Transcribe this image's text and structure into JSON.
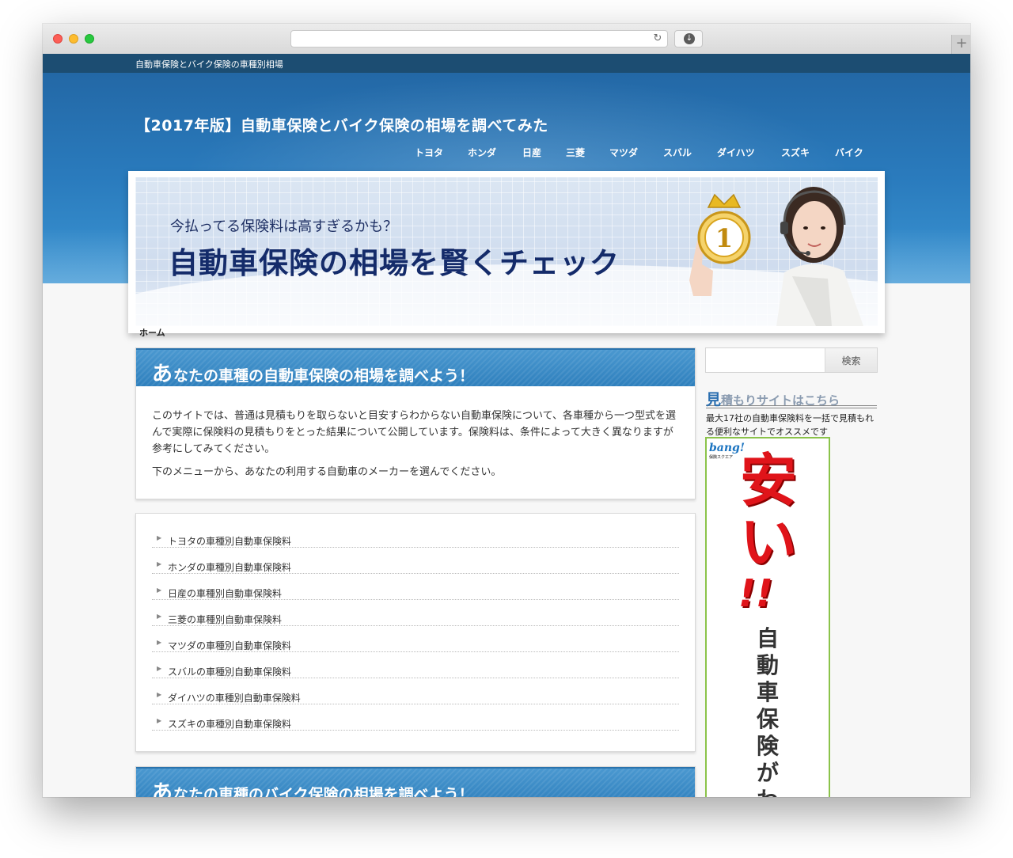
{
  "page": {
    "topbar_text": "自動車保険とバイク保険の車種別相場",
    "site_title": "【2017年版】自動車保険とバイク保険の相場を調べてみた"
  },
  "nav": {
    "items": [
      "トヨタ",
      "ホンダ",
      "日産",
      "三菱",
      "マツダ",
      "スバル",
      "ダイハツ",
      "スズキ",
      "バイク"
    ]
  },
  "banner": {
    "subtitle": "今払ってる保険料は高すぎるかも？",
    "headline": "自動車保険の相場を賢くチェック",
    "crown_number": "1"
  },
  "breadcrumb": {
    "home": "ホーム"
  },
  "car_section": {
    "title_first": "あ",
    "title_rest": "なたの車種の自動車保険の相場を調べよう！",
    "paragraph1": "このサイトでは、普通は見積もりを取らないと目安すらわからない自動車保険について、各車種から一つ型式を選んで実際に保険料の見積もりをとった結果について公開しています。保険料は、条件によって大きく異なりますが参考にしてみてください。",
    "paragraph2": "下のメニューから、あなたの利用する自動車のメーカーを選んでください。"
  },
  "maker_list": {
    "items": [
      "トヨタの車種別自動車保険料",
      "ホンダの車種別自動車保険料",
      "日産の車種別自動車保険料",
      "三菱の車種別自動車保険料",
      "マツダの車種別自動車保険料",
      "スバルの車種別自動車保険料",
      "ダイハツの車種別自動車保険料",
      "スズキの車種別自動車保険料"
    ]
  },
  "bike_section": {
    "title_first": "あ",
    "title_rest": "なたの車種のバイク保険の相場を調べよう！"
  },
  "sidebar": {
    "search_placeholder": "",
    "search_button": "検索",
    "widget_title_first": "見",
    "widget_title_rest": "積もりサイトはこちら",
    "widget_desc": "最大17社の自動車保険料を一括で見積もれる便利なサイトでオススメです",
    "ad": {
      "logo": "bang!",
      "logo_sub": "保険スクエア",
      "cheap": "安い",
      "exclaim": "!!",
      "vertical": "自動車保険がわかる"
    }
  },
  "colors": {
    "topbar": "#1c4d72",
    "hero": "#2a7bbd",
    "section_head": "#3a8bc6",
    "ad_border": "#8bc34a",
    "ad_red": "#e0141a"
  },
  "icons": [
    "reload-icon",
    "download-icon",
    "new-tab-icon",
    "crown-icon",
    "list-arrow-icon"
  ]
}
